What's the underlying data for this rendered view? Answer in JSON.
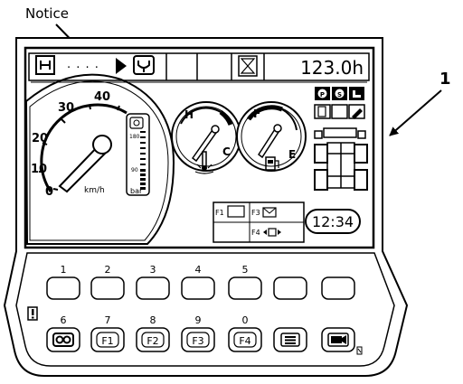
{
  "callouts": {
    "notice_label": "Notice",
    "item_number": "1"
  },
  "header": {
    "dots": "· · · ·",
    "hour_meter": "123.0h"
  },
  "speedometer": {
    "tick_labels": [
      "0",
      "10",
      "20",
      "30",
      "40"
    ],
    "unit": "km/h",
    "pressure_max": "180",
    "pressure_mid": "90",
    "pressure_unit": "bar"
  },
  "temp_gauge": {
    "high": "H",
    "low": "C"
  },
  "fuel_gauge": {
    "full": "F",
    "empty": "E"
  },
  "function_labels": {
    "f1": "F1",
    "f3": "F3",
    "f4": "F4"
  },
  "clock": {
    "time": "12:34"
  },
  "keypad": {
    "top_row_numbers": [
      "1",
      "2",
      "3",
      "4",
      "5",
      "",
      ""
    ],
    "bottom_row_numbers": [
      "6",
      "7",
      "8",
      "9",
      "0",
      "",
      ""
    ],
    "bottom_row_labels": [
      "",
      "F1",
      "F2",
      "F3",
      "F4",
      "",
      ""
    ]
  },
  "icons": [
    "hourglass-start-icon",
    "wrench-icon",
    "arrow-icon",
    "hourglass-icon",
    "parking-brake-icon",
    "service-icon",
    "seat-icon",
    "door-icon",
    "key-icon",
    "pressure-gauge-icon",
    "coolant-icon",
    "fuel-pump-icon",
    "chassis-icon",
    "warning-icon",
    "menu-icon",
    "camera-icon"
  ]
}
